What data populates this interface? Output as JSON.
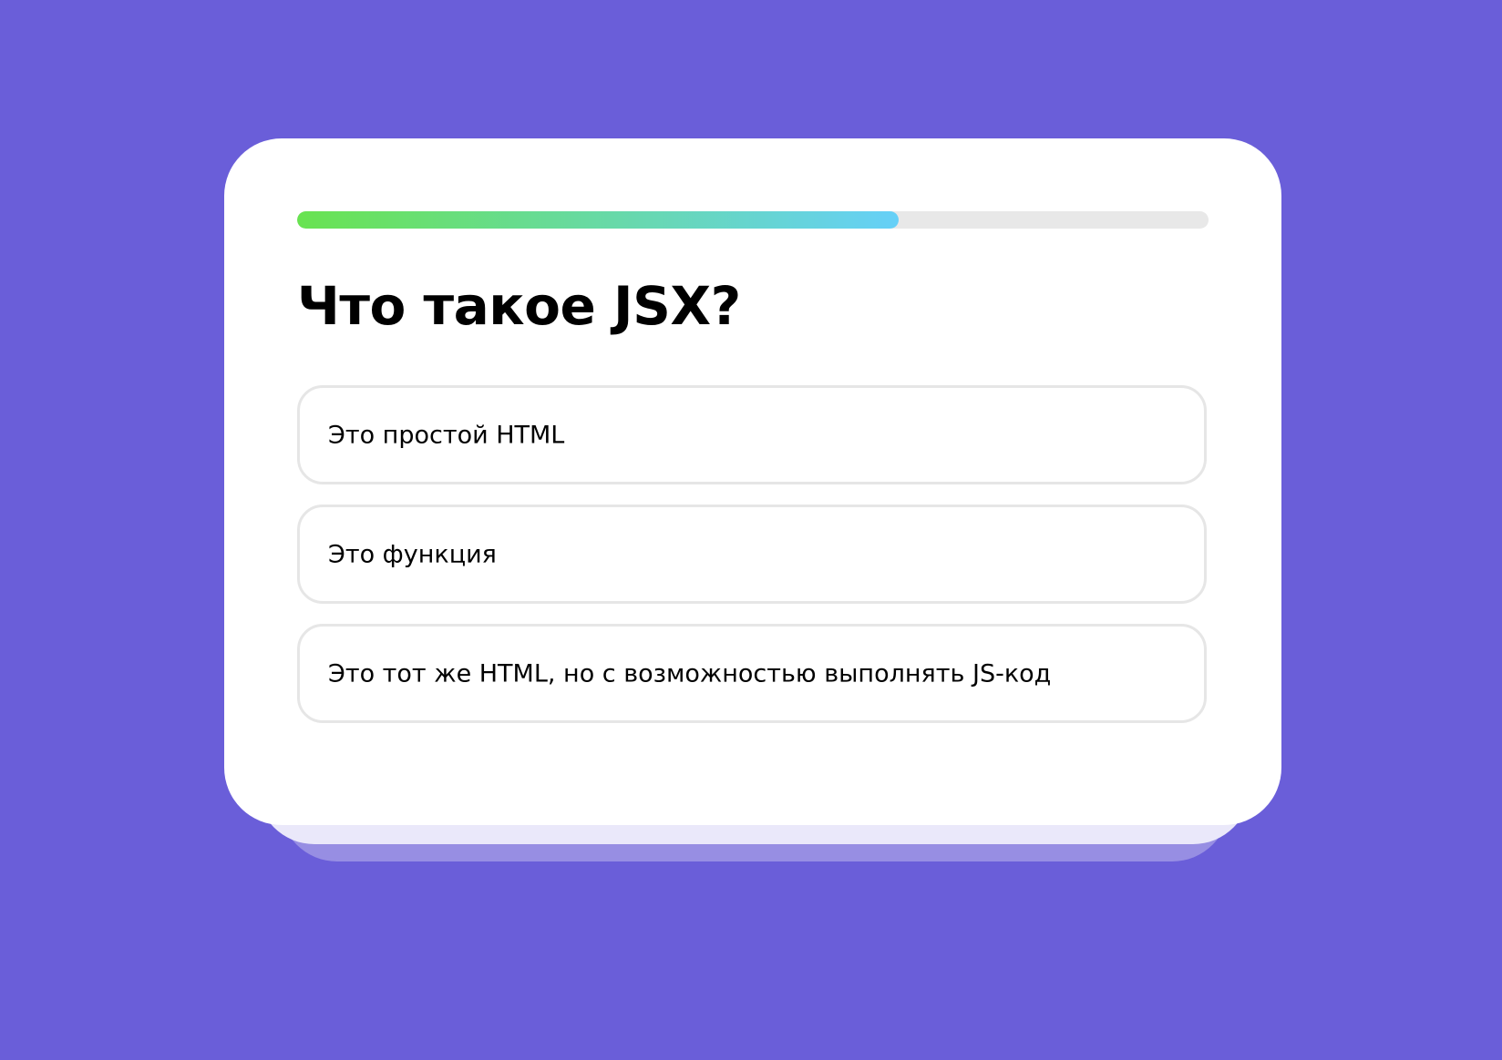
{
  "quiz": {
    "progress": 0.66,
    "question": "Что такое JSX?",
    "options": [
      {
        "label": "Это простой HTML"
      },
      {
        "label": "Это функция"
      },
      {
        "label": "Это тот же HTML, но с возможностью выполнять JS-код"
      }
    ]
  },
  "colors": {
    "background": "#6a5ed9",
    "progress_start": "#68e350",
    "progress_end": "#66d0f8",
    "track": "#e8e8e8"
  }
}
